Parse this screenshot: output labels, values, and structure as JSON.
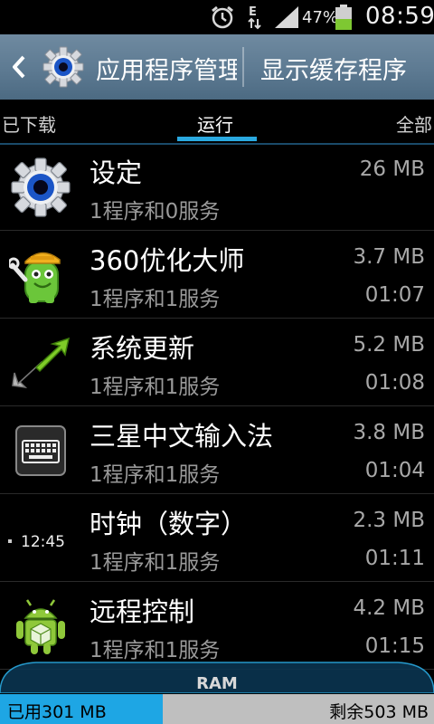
{
  "status_bar": {
    "battery_percent": "47%",
    "time": "08:59",
    "alarm_icon": "alarm-clock-icon",
    "data_icon": "edge-data-icon",
    "signal_icon": "signal-bars-icon",
    "battery_icon": "battery-icon"
  },
  "action_bar": {
    "back_icon": "back-arrow-icon",
    "app_icon": "settings-gear-icon",
    "title": "应用程序管理器",
    "action_label": "显示缓存程序"
  },
  "tabs": {
    "left": "已下载",
    "active": "运行",
    "right": "全部"
  },
  "apps": [
    {
      "name": "设定",
      "sub": "1程序和0服务",
      "size": "26 MB",
      "time": "",
      "icon": "settings-gear-icon"
    },
    {
      "name": "360优化大师",
      "sub": "1程序和1服务",
      "size": "3.7 MB",
      "time": "01:07",
      "icon": "360-optimizer-robot-icon"
    },
    {
      "name": "系统更新",
      "sub": "1程序和1服务",
      "size": "5.2 MB",
      "time": "01:08",
      "icon": "system-update-arrows-icon"
    },
    {
      "name": "三星中文输入法",
      "sub": "1程序和1服务",
      "size": "3.8 MB",
      "time": "01:04",
      "icon": "keyboard-icon"
    },
    {
      "name": "时钟（数字）",
      "sub": "1程序和1服务",
      "size": "2.3 MB",
      "time": "01:11",
      "icon": "digital-clock-icon",
      "icon_text": "12:45"
    },
    {
      "name": "远程控制",
      "sub": "1程序和1服务",
      "size": "4.2 MB",
      "time": "01:15",
      "icon": "android-robot-icon"
    }
  ],
  "ram": {
    "label": "RAM",
    "used": "已用301 MB",
    "free": "剩余503 MB",
    "used_fraction": 0.374,
    "used_color": "#1ea6e4"
  },
  "colors": {
    "action_bar": "#5d7a92",
    "tab_indicator": "#2aa9e0"
  }
}
